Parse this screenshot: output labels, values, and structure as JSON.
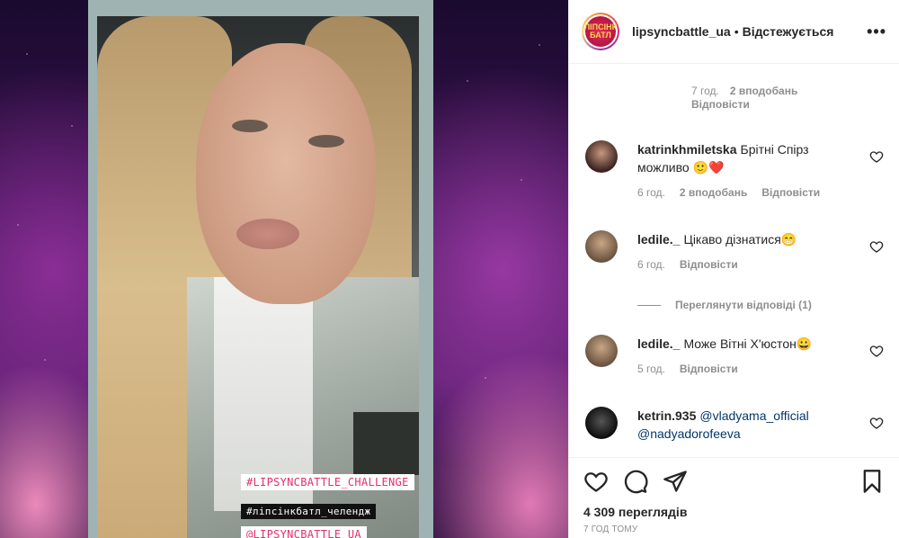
{
  "post": {
    "stickers": [
      "#LIPSYNCBATTLE_CHALLENGE",
      "#ліпсінкбатл_челендж",
      "@LIPSYNCBATTLE_UA"
    ]
  },
  "header": {
    "username": "lipsyncbattle_ua",
    "separator": "•",
    "follow_status": "Відстежується",
    "more": "•••",
    "avatar_text": "ЛІПСІНК БАТЛ"
  },
  "comments": {
    "top_reply": {
      "time": "7 год.",
      "likes": "2 вподобань",
      "reply": "Відповісти"
    },
    "items": [
      {
        "user": "katrinkhmiletska",
        "text": "Брітні Спірз можливо 🙂❤️",
        "time": "6 год.",
        "likes": "2 вподобань",
        "reply": "Відповісти"
      },
      {
        "user": "ledile._",
        "text": "Цікаво дізнатися😁",
        "time": "6 год.",
        "reply": "Відповісти"
      },
      {
        "user": "ledile._",
        "text": "Може Вітні Х'юстон😀",
        "time": "5 год.",
        "reply": "Відповісти"
      },
      {
        "user": "ketrin.935",
        "mention1": "@vladyama_official",
        "mention2": "@nadyadorofeeva"
      }
    ],
    "view_replies": "Переглянути відповіді (1)"
  },
  "actions": {
    "views": "4 309 переглядів",
    "time": "7 год тому"
  },
  "colors": {
    "text": "#262626",
    "muted": "#8e8e8e",
    "link": "#00376b",
    "sticker_pink": "#e0316b"
  }
}
